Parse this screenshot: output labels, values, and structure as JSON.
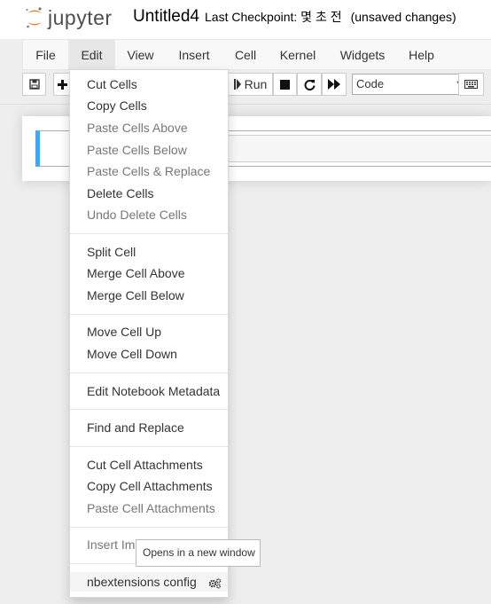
{
  "header": {
    "logo_text": "jupyter",
    "notebook_name": "Untitled4",
    "checkpoint": "Last Checkpoint: 몇 초 전",
    "autosave_status": "(unsaved changes)"
  },
  "menubar": {
    "items": [
      "File",
      "Edit",
      "View",
      "Insert",
      "Cell",
      "Kernel",
      "Widgets",
      "Help"
    ],
    "active": "Edit"
  },
  "toolbar": {
    "run_label": "Run",
    "cell_type": "Code",
    "icons": [
      "save-icon",
      "add-cell-icon",
      "run-icon",
      "stop-icon",
      "restart-icon",
      "fast-forward-icon",
      "keyboard-icon"
    ]
  },
  "edit_menu": {
    "items": [
      {
        "label": "Cut Cells",
        "disabled": false
      },
      {
        "label": "Copy Cells",
        "disabled": false
      },
      {
        "label": "Paste Cells Above",
        "disabled": true
      },
      {
        "label": "Paste Cells Below",
        "disabled": true
      },
      {
        "label": "Paste Cells & Replace",
        "disabled": true
      },
      {
        "label": "Delete Cells",
        "disabled": false
      },
      {
        "label": "Undo Delete Cells",
        "disabled": true
      },
      {
        "label": "Split Cell",
        "disabled": false
      },
      {
        "label": "Merge Cell Above",
        "disabled": false
      },
      {
        "label": "Merge Cell Below",
        "disabled": false
      },
      {
        "label": "Move Cell Up",
        "disabled": false
      },
      {
        "label": "Move Cell Down",
        "disabled": false
      },
      {
        "label": "Edit Notebook Metadata",
        "disabled": false
      },
      {
        "label": "Find and Replace",
        "disabled": false
      },
      {
        "label": "Cut Cell Attachments",
        "disabled": false
      },
      {
        "label": "Copy Cell Attachments",
        "disabled": false
      },
      {
        "label": "Paste Cell Attachments",
        "disabled": true
      },
      {
        "label": "Insert Ima",
        "disabled": true
      },
      {
        "label": "nbextensions config",
        "disabled": false
      }
    ]
  },
  "tooltip": {
    "text": "Opens in a new window"
  },
  "colors": {
    "jupyter_orange": "#f37726",
    "cell_selected_border": "#42a5f5",
    "disabled_text": "#777777"
  }
}
